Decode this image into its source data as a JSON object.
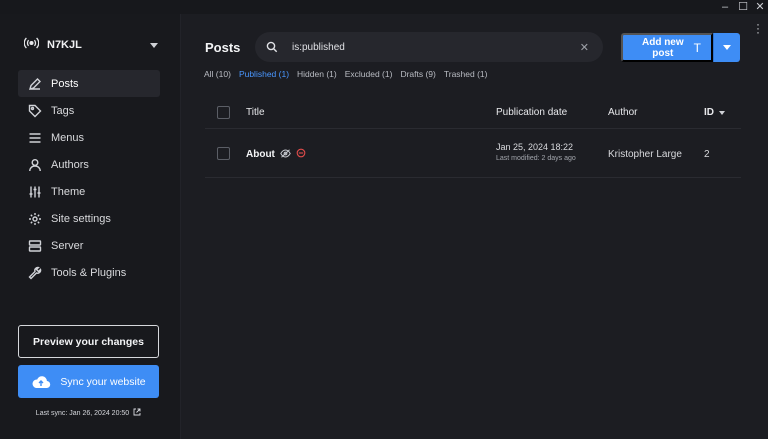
{
  "window": {
    "controls": {
      "minimize": "–",
      "maximize": "☐",
      "close": "✕"
    }
  },
  "sidebar": {
    "site_name": "N7KJL",
    "items": [
      {
        "label": "Posts",
        "icon": "pen-icon",
        "active": true
      },
      {
        "label": "Tags",
        "icon": "tag-icon",
        "active": false
      },
      {
        "label": "Menus",
        "icon": "menu-icon",
        "active": false
      },
      {
        "label": "Authors",
        "icon": "user-icon",
        "active": false
      },
      {
        "label": "Theme",
        "icon": "sliders-icon",
        "active": false
      },
      {
        "label": "Site settings",
        "icon": "gear-icon",
        "active": false
      },
      {
        "label": "Server",
        "icon": "server-icon",
        "active": false
      },
      {
        "label": "Tools & Plugins",
        "icon": "wrench-icon",
        "active": false
      }
    ],
    "preview_label": "Preview your changes",
    "sync_label": "Sync your website",
    "last_sync": "Last sync: Jan 26, 2024 20:50"
  },
  "main": {
    "title": "Posts",
    "search": {
      "value": "is:published",
      "clear": "✕"
    },
    "add_button": "Add new post",
    "add_button_icon": "T",
    "filters": [
      {
        "label": "All (10)",
        "active": false
      },
      {
        "label": "Published (1)",
        "active": true
      },
      {
        "label": "Hidden (1)",
        "active": false
      },
      {
        "label": "Excluded (1)",
        "active": false
      },
      {
        "label": "Drafts (9)",
        "active": false
      },
      {
        "label": "Trashed (1)",
        "active": false
      }
    ],
    "table": {
      "columns": {
        "title": "Title",
        "date": "Publication date",
        "author": "Author",
        "id": "ID"
      },
      "rows": [
        {
          "title": "About",
          "date": "Jan 25, 2024 18:22",
          "modified": "Last modified: 2 days ago",
          "author": "Kristopher Large",
          "id": "2"
        }
      ]
    }
  },
  "colors": {
    "accent": "#3e8df5",
    "background": "#1c1d22",
    "sidebar": "#18191d",
    "excluded_icon": "#e24c4b"
  }
}
